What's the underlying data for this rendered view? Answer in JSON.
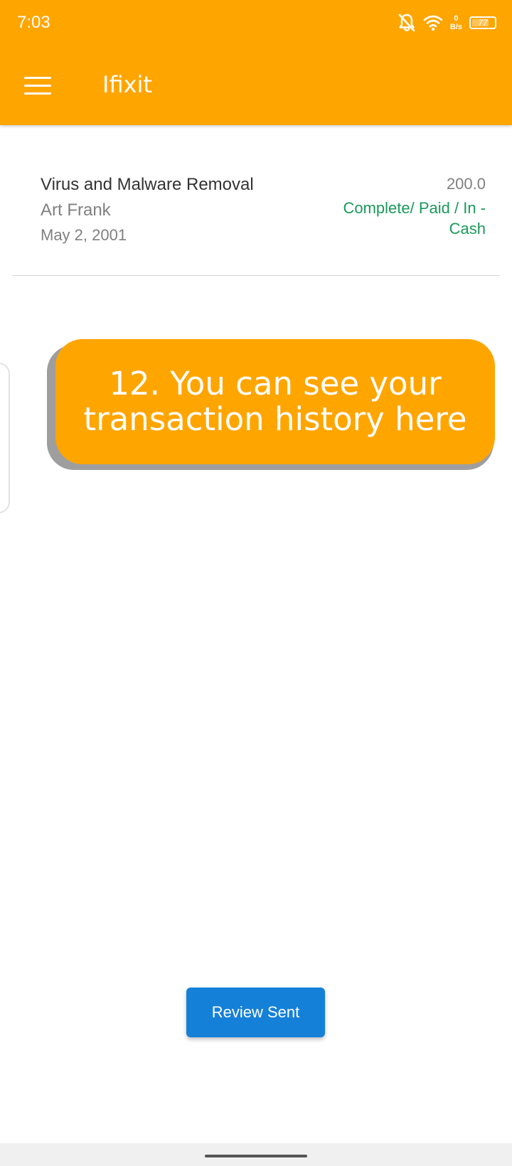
{
  "status_bar": {
    "time": "7:03",
    "net_speed_value": "0",
    "net_speed_unit": "B/s",
    "battery_level": "77",
    "icons": [
      "bell-off-icon",
      "wifi-icon",
      "battery-icon"
    ]
  },
  "app_bar": {
    "title": "Ifixit",
    "menu_icon": "hamburger-menu-icon",
    "background_color": "#FFA500"
  },
  "transactions": [
    {
      "service": "Virus and Malware Removal",
      "customer": "Art Frank",
      "date": "May 2, 2001",
      "amount": "200.0",
      "status": "Complete/ Paid / In - Cash",
      "status_color": "#1A9A5A"
    }
  ],
  "tooltip": {
    "text": "12. You can see your transaction history here",
    "color": "#FFA500"
  },
  "footer": {
    "review_button_label": "Review Sent",
    "review_button_color": "#1580D8"
  }
}
